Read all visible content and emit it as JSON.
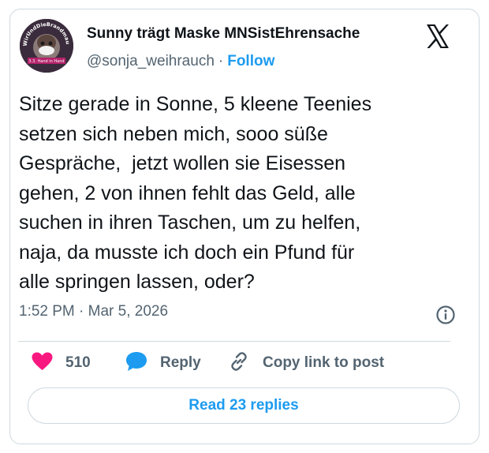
{
  "author": {
    "display_name": "Sunny trägt Maske MNSistEhrensache",
    "handle": "@sonja_weihrauch",
    "separator": "·",
    "follow_label": "Follow",
    "avatar_text_top": "#WirUndDieBrandmauer",
    "avatar_text_bottom": "3.3. Hand in Hand"
  },
  "tweet": {
    "text": "Sitze gerade in Sonne, 5 kleene Teenies\nsetzen sich neben mich, sooo süße\nGespräche,  jetzt wollen sie Eisessen\ngehen, 2 von ihnen fehlt das Geld, alle\nsuchen in ihren Taschen, um zu helfen,\nnaja, da musste ich doch ein Pfund für\nalle springen lassen, oder?",
    "timestamp": "1:52 PM · Mar 5, 2026"
  },
  "actions": {
    "like_count": "510",
    "reply_label": "Reply",
    "copy_label": "Copy link to post"
  },
  "read_replies_label": "Read 23 replies",
  "colors": {
    "accent": "#1d9bf0",
    "heart": "#f91880",
    "muted": "#536471",
    "border": "#cfd9de"
  },
  "icons": [
    "x-logo-icon",
    "info-icon",
    "heart-icon",
    "reply-bubble-icon",
    "link-icon"
  ]
}
